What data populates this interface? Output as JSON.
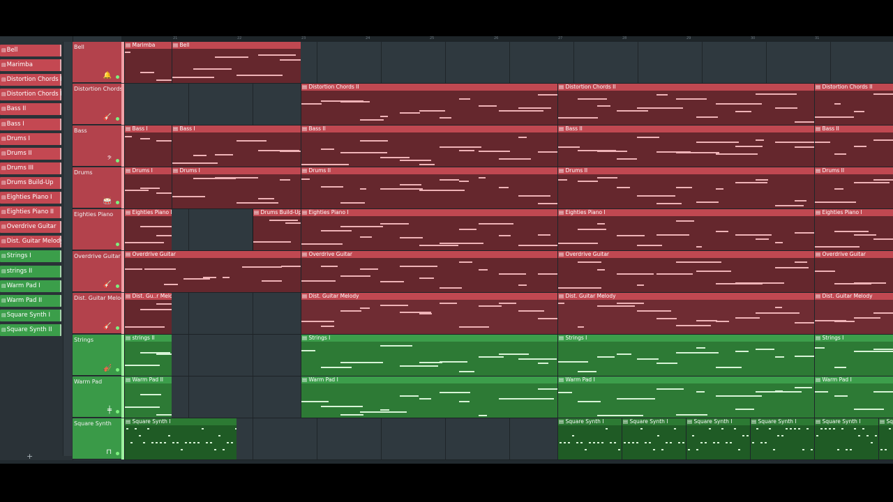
{
  "picker": {
    "items": [
      {
        "label": "Bell",
        "color": "red"
      },
      {
        "label": "Marimba",
        "color": "red"
      },
      {
        "label": "Distortion Chords I",
        "color": "red"
      },
      {
        "label": "Distortion Chords II",
        "color": "red"
      },
      {
        "label": "Bass II",
        "color": "red"
      },
      {
        "label": "Bass I",
        "color": "red"
      },
      {
        "label": "Drums I",
        "color": "red"
      },
      {
        "label": "Drums II",
        "color": "red"
      },
      {
        "label": "Drums III",
        "color": "red"
      },
      {
        "label": "Drums Build-Up",
        "color": "red"
      },
      {
        "label": "Eighties Piano I",
        "color": "red"
      },
      {
        "label": "Eighties Piano II",
        "color": "red"
      },
      {
        "label": "Overdrive Guitar",
        "color": "red"
      },
      {
        "label": "Dist. Guitar Melody",
        "color": "red"
      },
      {
        "label": "Strings I",
        "color": "green"
      },
      {
        "label": "strings II",
        "color": "green"
      },
      {
        "label": "Warm Pad I",
        "color": "green"
      },
      {
        "label": "Warm Pad II",
        "color": "green"
      },
      {
        "label": "Square Synth I",
        "color": "green"
      },
      {
        "label": "Square Synth II",
        "color": "green"
      }
    ],
    "add_label": "+"
  },
  "ruler": [
    "21",
    "22",
    "23",
    "24",
    "25",
    "26",
    "27",
    "28",
    "29",
    "30",
    "31"
  ],
  "tracks": [
    {
      "name": "Bell",
      "icon": "bell-icon",
      "glyph": "🔔",
      "color": "red",
      "clips": [
        {
          "label": "Marimba",
          "start": 0,
          "len": 68,
          "kind": "red"
        },
        {
          "label": "Bell",
          "start": 68,
          "len": 185,
          "kind": "red"
        }
      ]
    },
    {
      "name": "Distortion Chords",
      "icon": "guitar-icon",
      "glyph": "🎸",
      "color": "red",
      "clips": [
        {
          "label": "Distortion Chords II",
          "start": 253,
          "len": 368,
          "kind": "red"
        },
        {
          "label": "Distortion Chords II",
          "start": 621,
          "len": 368,
          "kind": "red"
        },
        {
          "label": "Distortion Chords II",
          "start": 989,
          "len": 113,
          "kind": "red"
        }
      ]
    },
    {
      "name": "Bass",
      "icon": "bass-clef-icon",
      "glyph": "𝄢",
      "color": "red",
      "clips": [
        {
          "label": "Bass I",
          "start": 0,
          "len": 68,
          "kind": "red"
        },
        {
          "label": "Bass I",
          "start": 68,
          "len": 185,
          "kind": "red"
        },
        {
          "label": "Bass II",
          "start": 253,
          "len": 368,
          "kind": "red"
        },
        {
          "label": "Bass II",
          "start": 621,
          "len": 368,
          "kind": "red"
        },
        {
          "label": "Bass II",
          "start": 989,
          "len": 113,
          "kind": "red"
        }
      ]
    },
    {
      "name": "Drums",
      "icon": "drum-icon",
      "glyph": "🥁",
      "color": "red",
      "clips": [
        {
          "label": "Drums I",
          "start": 0,
          "len": 68,
          "kind": "red"
        },
        {
          "label": "Drums I",
          "start": 68,
          "len": 185,
          "kind": "red"
        },
        {
          "label": "Drums II",
          "start": 253,
          "len": 368,
          "kind": "red"
        },
        {
          "label": "Drums II",
          "start": 621,
          "len": 368,
          "kind": "red"
        },
        {
          "label": "Drums II",
          "start": 989,
          "len": 113,
          "kind": "red"
        }
      ]
    },
    {
      "name": "Eighties Piano",
      "icon": "piano-icon",
      "glyph": "",
      "color": "red",
      "clips": [
        {
          "label": "Eighties Piano II",
          "start": 0,
          "len": 68,
          "kind": "red"
        },
        {
          "label": "Drums Build-Up",
          "start": 184,
          "len": 69,
          "kind": "red"
        },
        {
          "label": "Eighties Piano I",
          "start": 253,
          "len": 368,
          "kind": "red"
        },
        {
          "label": "Eighties Piano I",
          "start": 621,
          "len": 368,
          "kind": "red"
        },
        {
          "label": "Eighties Piano I",
          "start": 989,
          "len": 113,
          "kind": "red"
        }
      ]
    },
    {
      "name": "Overdrive Guitar",
      "icon": "guitar-icon",
      "glyph": "🎸",
      "color": "red",
      "clips": [
        {
          "label": "Overdrive Guitar",
          "start": 0,
          "len": 253,
          "kind": "red"
        },
        {
          "label": "Overdrive Guitar",
          "start": 253,
          "len": 368,
          "kind": "red"
        },
        {
          "label": "Overdrive Guitar",
          "start": 621,
          "len": 368,
          "kind": "red"
        },
        {
          "label": "Overdrive Guitar",
          "start": 989,
          "len": 113,
          "kind": "red"
        }
      ]
    },
    {
      "name": "Dist. Guitar Melody",
      "icon": "guitar-icon",
      "glyph": "🎸",
      "color": "red",
      "clips": [
        {
          "label": "Dist. Gu..r Melody",
          "start": 0,
          "len": 68,
          "kind": "red"
        },
        {
          "label": "Dist. Guitar Melody",
          "start": 253,
          "len": 368,
          "kind": "red sel"
        },
        {
          "label": "Dist. Guitar Melody",
          "start": 621,
          "len": 368,
          "kind": "red sel"
        },
        {
          "label": "Dist. Guitar Melody",
          "start": 989,
          "len": 113,
          "kind": "red sel"
        }
      ]
    },
    {
      "name": "Strings",
      "icon": "violin-icon",
      "glyph": "🎻",
      "color": "green",
      "clips": [
        {
          "label": "strings II",
          "start": 0,
          "len": 68,
          "kind": "green"
        },
        {
          "label": "Strings I",
          "start": 253,
          "len": 368,
          "kind": "green"
        },
        {
          "label": "Strings I",
          "start": 621,
          "len": 368,
          "kind": "green"
        },
        {
          "label": "Strings I",
          "start": 989,
          "len": 113,
          "kind": "green"
        }
      ]
    },
    {
      "name": "Warm Pad",
      "icon": "pad-icon",
      "glyph": "╪",
      "color": "green",
      "clips": [
        {
          "label": "Warm Pad II",
          "start": 0,
          "len": 68,
          "kind": "green"
        },
        {
          "label": "Warm Pad I",
          "start": 253,
          "len": 368,
          "kind": "green"
        },
        {
          "label": "Warm Pad I",
          "start": 621,
          "len": 368,
          "kind": "green"
        },
        {
          "label": "Warm Pad I",
          "start": 989,
          "len": 113,
          "kind": "green"
        }
      ]
    },
    {
      "name": "Square Synth",
      "icon": "square-wave-icon",
      "glyph": "⊓",
      "color": "green",
      "clips": [
        {
          "label": "Square Synth I",
          "start": 0,
          "len": 161,
          "kind": "dgreen"
        },
        {
          "label": "Square Synth I",
          "start": 621,
          "len": 92,
          "kind": "dgreen"
        },
        {
          "label": "Square Synth I",
          "start": 713,
          "len": 92,
          "kind": "dgreen"
        },
        {
          "label": "Square Synth I",
          "start": 805,
          "len": 92,
          "kind": "dgreen"
        },
        {
          "label": "Square Synth I",
          "start": 897,
          "len": 92,
          "kind": "dgreen"
        },
        {
          "label": "Square Synth I",
          "start": 989,
          "len": 92,
          "kind": "dgreen"
        },
        {
          "label": "Square Synth I",
          "start": 1081,
          "len": 21,
          "kind": "dgreen"
        }
      ]
    }
  ],
  "colors": {
    "red": "#c44852",
    "green": "#3b9e4a",
    "red_header": "#b3424c",
    "green_header": "#3a9a48"
  }
}
